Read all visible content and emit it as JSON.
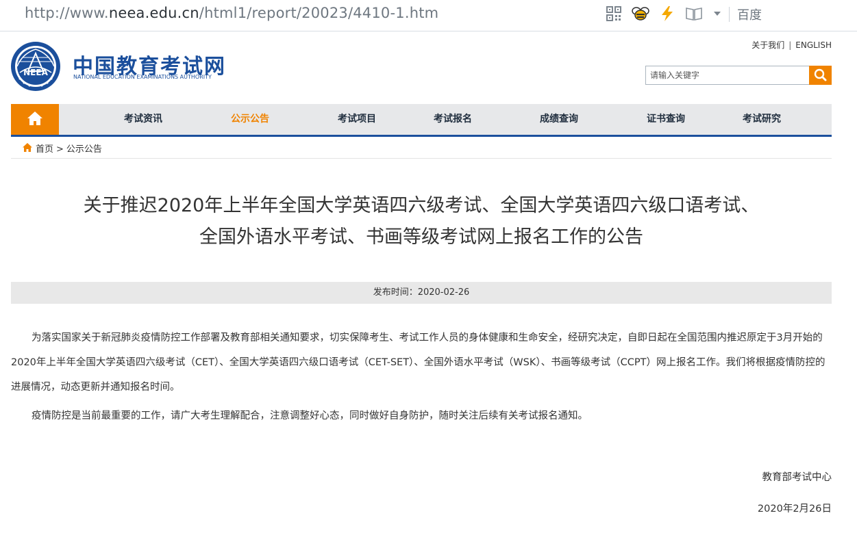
{
  "browser": {
    "url_prefix": "http://www.",
    "url_host": "neea.edu.cn",
    "url_path": "/html1/report/20023/4410-1.htm",
    "search_engine": "百度",
    "icons": [
      "qr-code-icon",
      "bee-icon",
      "lightning-icon",
      "reading-book-icon",
      "dropdown-arrow-icon"
    ]
  },
  "header": {
    "logo_cn": "中国教育考试网",
    "logo_en": "NATIONAL EDUCATION EXAMINATIONS AUTHORITY",
    "logo_emblem_text": "NEEA",
    "about_link": "关于我们",
    "separator": "|",
    "english_link": "ENGLISH",
    "search_placeholder": "请输入关键字"
  },
  "nav": {
    "items": [
      {
        "label": "考试资讯"
      },
      {
        "label": "公示公告",
        "active": true
      },
      {
        "label": "考试项目"
      },
      {
        "label": "考试报名"
      },
      {
        "label": "成绩查询"
      },
      {
        "label": "证书查询"
      },
      {
        "label": "考试研究"
      }
    ]
  },
  "breadcrumb": {
    "home": "首页",
    "arrow": ">",
    "current": "公示公告"
  },
  "article": {
    "title_line1": "关于推迟2020年上半年全国大学英语四六级考试、全国大学英语四六级口语考试、",
    "title_line2": "全国外语水平考试、书画等级考试网上报名工作的公告",
    "publish_time": "发布时间：2020-02-26",
    "paragraph1": "为落实国家关于新冠肺炎疫情防控工作部署及教育部相关通知要求，切实保障考生、考试工作人员的身体健康和生命安全，经研究决定，自即日起在全国范围内推迟原定于3月开始的2020年上半年全国大学英语四六级考试（CET）、全国大学英语四六级口语考试（CET-SET）、全国外语水平考试（WSK）、书画等级考试（CCPT）网上报名工作。我们将根据疫情防控的进展情况，动态更新并通知报名时间。",
    "paragraph2": "疫情防控是当前最重要的工作，请广大考生理解配合，注意调整好心态，同时做好自身防护，随时关注后续有关考试报名通知。",
    "signature": "教育部考试中心",
    "date": "2020年2月26日"
  },
  "colors": {
    "brand_blue": "#1b4f9c",
    "accent_orange": "#f08300",
    "nav_bg": "#e7e8ea"
  }
}
